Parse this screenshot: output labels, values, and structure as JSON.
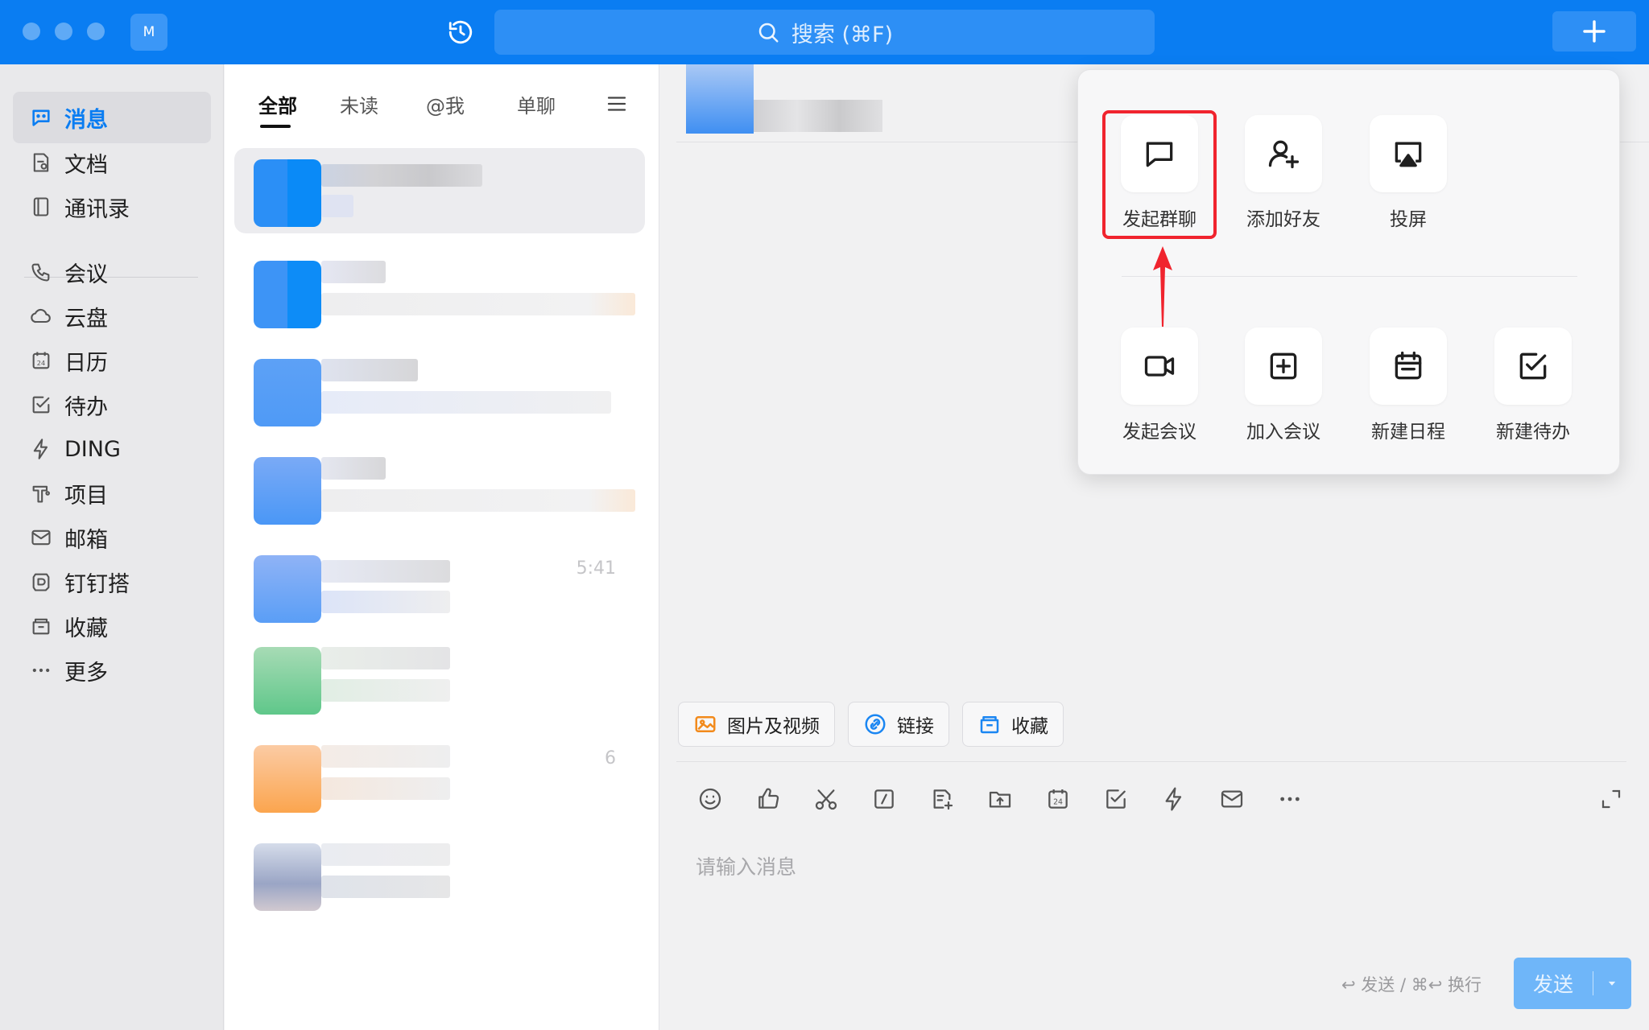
{
  "titlebar": {
    "avatar_initial": "M",
    "search_placeholder": "搜索 (⌘F)"
  },
  "nav": {
    "items": [
      {
        "label": "消息",
        "icon": "message-icon",
        "active": true
      },
      {
        "label": "文档",
        "icon": "document-icon"
      },
      {
        "label": "通讯录",
        "icon": "contacts-icon"
      },
      {
        "label": "会议",
        "icon": "meeting-phone-icon"
      },
      {
        "label": "云盘",
        "icon": "cloud-icon"
      },
      {
        "label": "日历",
        "icon": "calendar-icon"
      },
      {
        "label": "待办",
        "icon": "todo-icon"
      },
      {
        "label": "DING",
        "icon": "lightning-icon"
      },
      {
        "label": "项目",
        "icon": "project-icon"
      },
      {
        "label": "邮箱",
        "icon": "mail-icon"
      },
      {
        "label": "钉钉搭",
        "icon": "dingda-icon"
      },
      {
        "label": "收藏",
        "icon": "favorites-icon"
      },
      {
        "label": "更多",
        "icon": "more-icon"
      }
    ]
  },
  "list": {
    "tabs": [
      {
        "label": "全部",
        "active": true
      },
      {
        "label": "未读"
      },
      {
        "label": "@我"
      },
      {
        "label": "单聊"
      }
    ],
    "rows": [
      {
        "time": ""
      },
      {
        "time": ""
      },
      {
        "time": ""
      },
      {
        "time": ""
      },
      {
        "time": "5:41"
      },
      {
        "time": ""
      },
      {
        "time": "6"
      },
      {
        "time": ""
      }
    ]
  },
  "chat": {
    "chips": [
      {
        "label": "图片及视频",
        "icon": "image-icon"
      },
      {
        "label": "链接",
        "icon": "link-icon"
      },
      {
        "label": "收藏",
        "icon": "favorites-folder-icon"
      }
    ],
    "input_placeholder": "请输入消息",
    "hint": "↩ 发送 / ⌘↩ 换行",
    "send_label": "发送"
  },
  "popup": {
    "row1": [
      {
        "label": "发起群聊",
        "icon": "chat-bubble-icon",
        "highlighted": true
      },
      {
        "label": "添加好友",
        "icon": "add-friend-icon"
      },
      {
        "label": "投屏",
        "icon": "screen-cast-icon"
      }
    ],
    "row2": [
      {
        "label": "发起会议",
        "icon": "video-camera-icon"
      },
      {
        "label": "加入会议",
        "icon": "plus-square-icon"
      },
      {
        "label": "新建日程",
        "icon": "calendar-schedule-icon"
      },
      {
        "label": "新建待办",
        "icon": "checkbox-icon"
      }
    ]
  },
  "colors": {
    "brand": "#0a7df2",
    "highlight": "#f0242e"
  }
}
